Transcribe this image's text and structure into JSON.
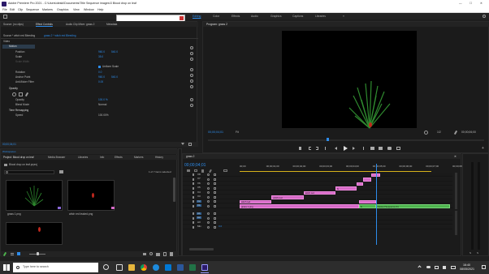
{
  "window": {
    "title": "Adobe Premiere Pro 2021 - C:\\Users\\deskl\\Documents\\Title Sequence images\\3 Blood drop on leaf",
    "min": "—",
    "max": "☐",
    "close": "✕"
  },
  "menu": [
    "File",
    "Edit",
    "Clip",
    "Sequence",
    "Markers",
    "Graphics",
    "View",
    "Window",
    "Help"
  ],
  "workspaces": [
    "Editing",
    "Color",
    "Effects",
    "Audio",
    "Graphics",
    "Captions",
    "Libraries"
  ],
  "workspace_more": "»",
  "tools_popup": {
    "icons": [
      "selection-tool-icon",
      "track-select-icon",
      "ripple-edit-icon",
      "razor-icon",
      "slip-icon",
      "pen-icon",
      "hand-icon",
      "type-icon"
    ]
  },
  "effect_controls": {
    "tabs": [
      "Source: (no clips)",
      "Effect Controls",
      "Audio Clip Mixer: grass 2",
      "Metadata"
    ],
    "clip_path": "Source * witch red Bleeding",
    "seq_path": "grass 2 * witch red Bleeding",
    "video_label": "Video",
    "motion": {
      "label": "Motion",
      "rows": [
        {
          "name": "Position",
          "value": "960.0",
          "value2": "540.0"
        },
        {
          "name": "Scale",
          "value": "35.0"
        },
        {
          "name": "Scale Width",
          "value": ""
        },
        {
          "name": "",
          "value": "Uniform Scale"
        },
        {
          "name": "Rotation",
          "value": "0.0"
        },
        {
          "name": "Anchor Point",
          "value": "960.0",
          "value2": "540.0"
        },
        {
          "name": "Anti-flicker Filter",
          "value": "0.00"
        }
      ]
    },
    "opacity": {
      "label": "Opacity",
      "value_label": "Opacity",
      "value": "100.0 %",
      "blend_label": "Blend Mode",
      "blend": "Normal"
    },
    "time_remap": {
      "label": "Time Remapping",
      "speed_label": "Speed",
      "speed": "100.00%"
    },
    "timecode": "00;00;04;01"
  },
  "program": {
    "tab": "Program: grass 2",
    "timecode": "00;00;04;01",
    "fit": "Fit",
    "fraction": "1/2",
    "duration": "00;00;06;00",
    "scrub_pct": 0.43
  },
  "project": {
    "tabs": [
      "Project: Blood drop on leaf",
      "Media Browser",
      "Libraries",
      "Info",
      "Effects",
      "Markers",
      "History"
    ],
    "file": "Blood drop on leaf.prproj",
    "count": "1 of 7 items selected",
    "items": [
      {
        "name": "grass 1.png",
        "duration": "",
        "kind": "grass"
      },
      {
        "name": "witch red leaked.png",
        "duration": "",
        "kind": "drop"
      },
      {
        "name": "",
        "duration": "",
        "kind": "drop2"
      }
    ]
  },
  "timeline": {
    "tab": "grass 2",
    "timecode": "00;00;04;01",
    "ruler": [
      "00;00",
      "00;00;01;00",
      "00;00;02;00",
      "00;00;03;00",
      "00;00;04;00",
      "00;00;05;00",
      "00;00;06;00",
      "00;00;07;00",
      "00;00;08;00"
    ],
    "video_tracks": [
      "V8",
      "V7",
      "V6",
      "V5",
      "V4",
      "V3",
      "V2",
      "V1"
    ],
    "audio_tracks": [
      "A1",
      "A2",
      "A3",
      "Mix"
    ],
    "mix_value": "0.0",
    "clips": [
      {
        "track": 0,
        "start": 0.62,
        "end": 0.66,
        "label": "",
        "color": "pink"
      },
      {
        "track": 1,
        "start": 0.58,
        "end": 0.62,
        "label": "",
        "color": "pink"
      },
      {
        "track": 2,
        "start": 0.55,
        "end": 0.58,
        "label": "",
        "color": "pink"
      },
      {
        "track": 3,
        "start": 0.45,
        "end": 0.55,
        "label": "fx",
        "color": "pink"
      },
      {
        "track": 4,
        "start": 0.3,
        "end": 0.45,
        "label": "witch red",
        "color": "pink"
      },
      {
        "track": 5,
        "start": 0.15,
        "end": 0.3,
        "label": "witch red",
        "color": "pink"
      },
      {
        "track": 6,
        "start": 0.0,
        "end": 0.15,
        "label": "witch red",
        "color": "pink"
      },
      {
        "track": 6,
        "start": 0.56,
        "end": 0.64,
        "label": "",
        "color": "pink"
      },
      {
        "track": 7,
        "start": 0.0,
        "end": 0.56,
        "label": "grass 1.png",
        "color": "pink"
      },
      {
        "track": 7,
        "start": 0.56,
        "end": 0.64,
        "label": "fx",
        "color": "green"
      },
      {
        "track": 7,
        "start": 0.64,
        "end": 0.99,
        "label": "Nested Sequence 01",
        "color": "green"
      }
    ],
    "playhead_pct": 0.64
  },
  "taskbar": {
    "search_placeholder": "Type here to search",
    "time": "16:40",
    "date": "08/05/2021",
    "apps": [
      "task-view-icon",
      "widgets-icon",
      "file-explorer-icon",
      "chrome-icon",
      "edge-icon",
      "mail-icon",
      "word-icon",
      "excel-icon",
      "premiere-icon"
    ]
  },
  "colors": {
    "accent": "#2d8ceb",
    "pink": "#d56ac6",
    "green": "#4db34d",
    "premiere": "#2c1a6a"
  }
}
